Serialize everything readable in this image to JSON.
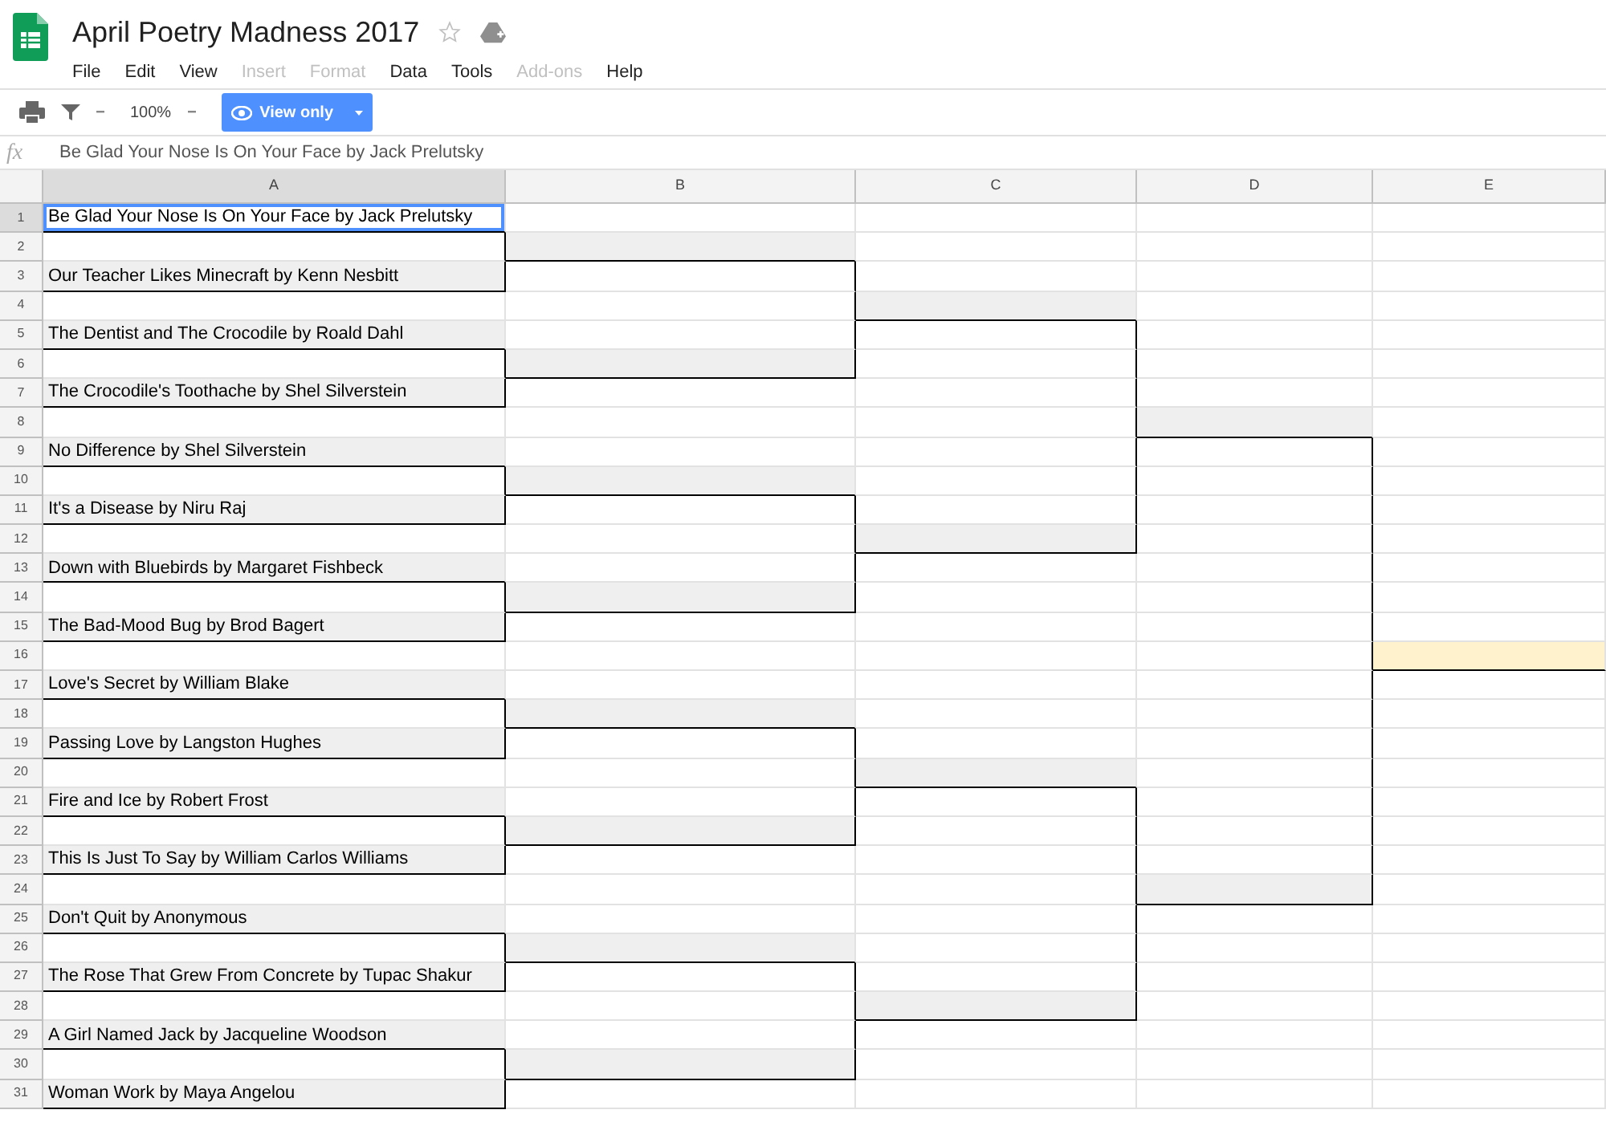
{
  "document": {
    "title": "April Poetry Madness 2017"
  },
  "menu": [
    {
      "label": "File",
      "disabled": false
    },
    {
      "label": "Edit",
      "disabled": false
    },
    {
      "label": "View",
      "disabled": false
    },
    {
      "label": "Insert",
      "disabled": true
    },
    {
      "label": "Format",
      "disabled": true
    },
    {
      "label": "Data",
      "disabled": false
    },
    {
      "label": "Tools",
      "disabled": false
    },
    {
      "label": "Add-ons",
      "disabled": true
    },
    {
      "label": "Help",
      "disabled": false
    }
  ],
  "toolbar": {
    "zoom": "100%",
    "mode_button": "View only"
  },
  "formula_bar": {
    "label": "fx",
    "value": "Be Glad Your Nose Is On Your Face by Jack Prelutsky"
  },
  "columns": [
    {
      "label": "A",
      "selected": true
    },
    {
      "label": "B",
      "selected": false
    },
    {
      "label": "C",
      "selected": false
    },
    {
      "label": "D",
      "selected": false
    },
    {
      "label": "E",
      "selected": false
    }
  ],
  "rows": [
    {
      "number": "1",
      "selected": true
    },
    {
      "number": "2",
      "selected": false
    },
    {
      "number": "3",
      "selected": false
    },
    {
      "number": "4",
      "selected": false
    },
    {
      "number": "5",
      "selected": false
    },
    {
      "number": "6",
      "selected": false
    },
    {
      "number": "7",
      "selected": false
    },
    {
      "number": "8",
      "selected": false
    },
    {
      "number": "9",
      "selected": false
    },
    {
      "number": "10",
      "selected": false
    },
    {
      "number": "11",
      "selected": false
    },
    {
      "number": "12",
      "selected": false
    },
    {
      "number": "13",
      "selected": false
    },
    {
      "number": "14",
      "selected": false
    },
    {
      "number": "15",
      "selected": false
    },
    {
      "number": "16",
      "selected": false
    },
    {
      "number": "17",
      "selected": false
    },
    {
      "number": "18",
      "selected": false
    },
    {
      "number": "19",
      "selected": false
    },
    {
      "number": "20",
      "selected": false
    },
    {
      "number": "21",
      "selected": false
    },
    {
      "number": "22",
      "selected": false
    },
    {
      "number": "23",
      "selected": false
    },
    {
      "number": "24",
      "selected": false
    },
    {
      "number": "25",
      "selected": false
    },
    {
      "number": "26",
      "selected": false
    },
    {
      "number": "27",
      "selected": false
    },
    {
      "number": "28",
      "selected": false
    },
    {
      "number": "29",
      "selected": false
    },
    {
      "number": "30",
      "selected": false
    },
    {
      "number": "31",
      "selected": false
    }
  ],
  "bracket": {
    "entries": [
      {
        "text": "Be Glad Your Nose Is On Your Face by Jack Prelutsky",
        "selected": true
      },
      {
        "text": "Our Teacher Likes Minecraft by Kenn Nesbitt",
        "selected": false
      },
      {
        "text": "The Dentist and The Crocodile by Roald Dahl",
        "selected": false
      },
      {
        "text": "The Crocodile's Toothache by Shel Silverstein",
        "selected": false
      },
      {
        "text": "No Difference by Shel Silverstein",
        "selected": false
      },
      {
        "text": "It's a Disease by Niru Raj",
        "selected": false
      },
      {
        "text": "Down with Bluebirds by Margaret Fishbeck",
        "selected": false
      },
      {
        "text": "The Bad-Mood Bug by Brod Bagert",
        "selected": false
      },
      {
        "text": "Love's Secret by William Blake",
        "selected": false
      },
      {
        "text": "Passing Love by Langston Hughes",
        "selected": false
      },
      {
        "text": "Fire and Ice by Robert Frost",
        "selected": false
      },
      {
        "text": "This Is Just To Say by William Carlos Williams",
        "selected": false
      },
      {
        "text": "Don't Quit by Anonymous",
        "selected": false
      },
      {
        "text": "The Rose That Grew From Concrete by Tupac Shakur",
        "selected": false
      },
      {
        "text": "A Girl Named Jack by Jacqueline Woodson",
        "selected": false
      },
      {
        "text": "Woman Work by Maya Angelou",
        "selected": false
      }
    ],
    "rounds": [
      {
        "slots": [
          {
            "highlighted": false
          },
          {
            "highlighted": false
          },
          {
            "highlighted": false
          },
          {
            "highlighted": false
          },
          {
            "highlighted": false
          },
          {
            "highlighted": false
          },
          {
            "highlighted": false
          },
          {
            "highlighted": false
          }
        ]
      },
      {
        "slots": [
          {
            "highlighted": false
          },
          {
            "highlighted": false
          },
          {
            "highlighted": false
          },
          {
            "highlighted": false
          }
        ]
      },
      {
        "slots": [
          {
            "highlighted": false
          },
          {
            "highlighted": false
          }
        ]
      },
      {
        "slots": [
          {
            "highlighted": true
          }
        ]
      }
    ]
  }
}
